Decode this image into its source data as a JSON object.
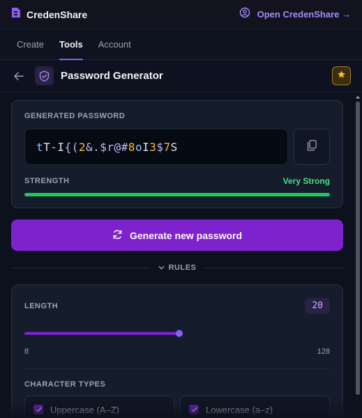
{
  "app": {
    "name": "CredenShare",
    "open_link": "Open CredenShare →"
  },
  "tabs": [
    {
      "label": "Create",
      "active": false
    },
    {
      "label": "Tools",
      "active": true
    },
    {
      "label": "Account",
      "active": false
    }
  ],
  "header": {
    "title": "Password Generator"
  },
  "generated": {
    "label": "GENERATED PASSWORD",
    "password": "tT-I{(2&.$r@#8oI3$7S",
    "strength_label": "STRENGTH",
    "strength_value": "Very Strong",
    "strength_fraction": 1.0
  },
  "generate_button": {
    "label": "Generate new password"
  },
  "rules": {
    "label": "RULES"
  },
  "length": {
    "label": "LENGTH",
    "value": "20",
    "min": "8",
    "max": "128",
    "current": 20
  },
  "character_types": {
    "label": "CHARACTER TYPES",
    "items": [
      {
        "label": "Uppercase (A–Z)",
        "checked": true
      },
      {
        "label": "Lowercase (a–z)",
        "checked": true
      }
    ]
  },
  "colors": {
    "accent": "#7e22ce",
    "strength": "#22c55e",
    "star": "#fbbf24"
  }
}
